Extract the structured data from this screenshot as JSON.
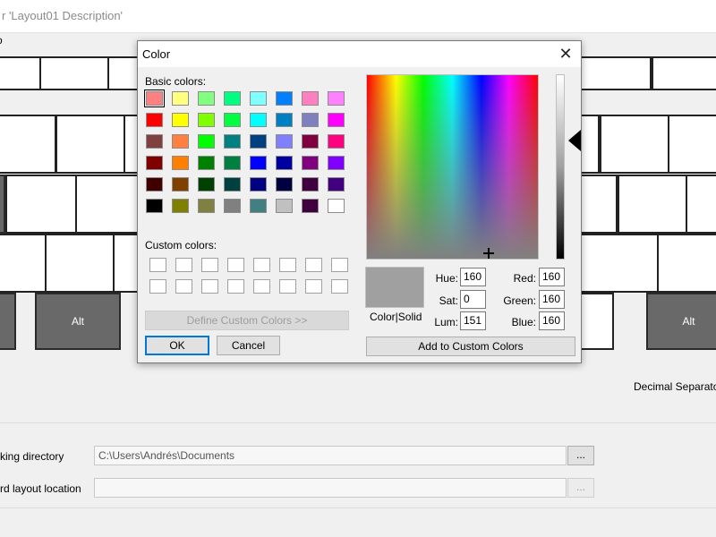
{
  "background": {
    "title": "r 'Layout01 Description'",
    "menu_text": "o",
    "left_alt_label": "Alt",
    "right_alt_label": "Alt",
    "decimal_separator_label": "Decimal Separato",
    "working_directory_label": "king directory",
    "working_directory_value": "C:\\Users\\Andrés\\Documents",
    "working_directory_browse": "...",
    "keyboard_location_label": "rd layout location",
    "keyboard_location_value": "",
    "keyboard_location_browse": "..."
  },
  "dialog": {
    "title": "Color",
    "close_icon": "close-icon",
    "basic_colors_label": "Basic colors:",
    "custom_colors_label": "Custom colors:",
    "define_custom_label": "Define Custom Colors >>",
    "ok_label": "OK",
    "cancel_label": "Cancel",
    "add_custom_label": "Add to Custom Colors",
    "color_solid_label": "Color|Solid",
    "hue_label": "Hue:",
    "hue_value": "160",
    "sat_label": "Sat:",
    "sat_value": "0",
    "lum_label": "Lum:",
    "lum_value": "151",
    "red_label": "Red:",
    "red_value": "160",
    "green_label": "Green:",
    "green_value": "160",
    "blue_label": "Blue:",
    "blue_value": "160",
    "preview_color": "#a0a0a0",
    "basic_colors": [
      "#ff8080",
      "#ffff80",
      "#80ff80",
      "#00ff80",
      "#80ffff",
      "#0080ff",
      "#ff80c0",
      "#ff80ff",
      "#ff0000",
      "#ffff00",
      "#80ff00",
      "#00ff40",
      "#00ffff",
      "#0080c0",
      "#8080c0",
      "#ff00ff",
      "#804040",
      "#ff8040",
      "#00ff00",
      "#008080",
      "#004080",
      "#8080ff",
      "#800040",
      "#ff0080",
      "#800000",
      "#ff8000",
      "#008000",
      "#008040",
      "#0000ff",
      "#0000a0",
      "#800080",
      "#8000ff",
      "#400000",
      "#804000",
      "#004000",
      "#004040",
      "#000080",
      "#000040",
      "#400040",
      "#400080",
      "#000000",
      "#808000",
      "#808040",
      "#808080",
      "#408080",
      "#c0c0c0",
      "#400040",
      "#ffffff"
    ],
    "custom_colors": [
      "#ffffff",
      "#ffffff",
      "#ffffff",
      "#ffffff",
      "#ffffff",
      "#ffffff",
      "#ffffff",
      "#ffffff",
      "#ffffff",
      "#ffffff",
      "#ffffff",
      "#ffffff",
      "#ffffff",
      "#ffffff",
      "#ffffff",
      "#ffffff"
    ]
  }
}
